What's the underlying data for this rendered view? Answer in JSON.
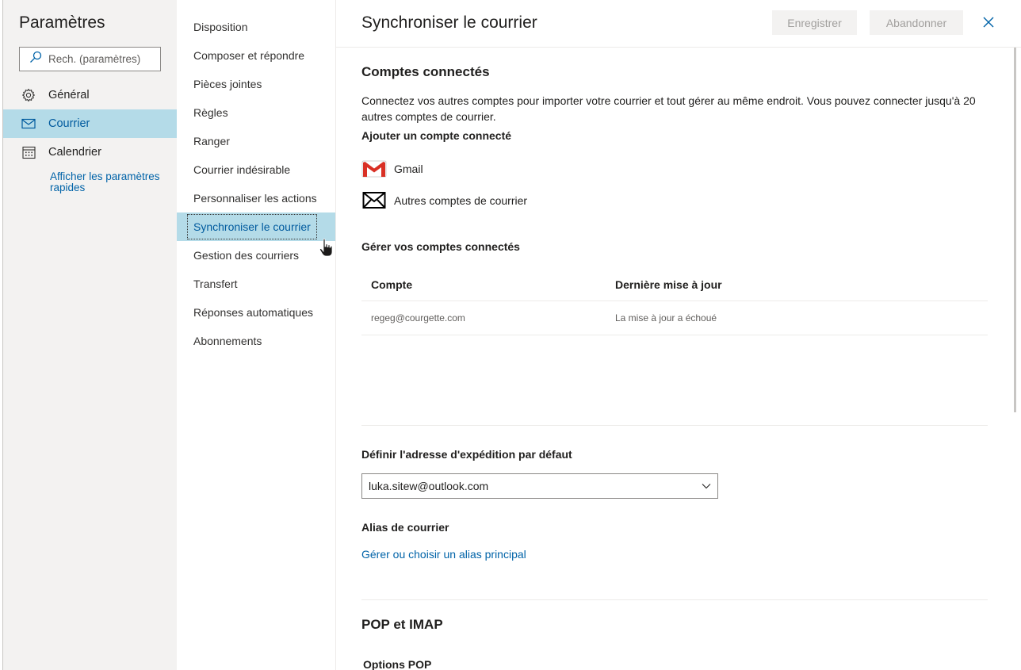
{
  "settings": {
    "title": "Paramètres",
    "search_placeholder": "Rech. (paramètres)",
    "categories": [
      {
        "label": "Général",
        "icon": "gear-icon"
      },
      {
        "label": "Courrier",
        "icon": "mail-icon",
        "active": true
      },
      {
        "label": "Calendrier",
        "icon": "calendar-icon"
      }
    ],
    "quick_settings_link": "Afficher les paramètres rapides"
  },
  "mail_nav": {
    "items": [
      "Disposition",
      "Composer et répondre",
      "Pièces jointes",
      "Règles",
      "Ranger",
      "Courrier indésirable",
      "Personnaliser les actions",
      "Synchroniser le courrier",
      "Gestion des courriers",
      "Transfert",
      "Réponses automatiques",
      "Abonnements"
    ],
    "active": "Synchroniser le courrier"
  },
  "main": {
    "title": "Synchroniser le courrier",
    "save_label": "Enregistrer",
    "discard_label": "Abandonner",
    "connected": {
      "heading": "Comptes connectés",
      "description": "Connectez vos autres comptes pour importer votre courrier et tout gérer au même endroit. Vous pouvez connecter jusqu'à 20 autres comptes de courrier.",
      "add_heading": "Ajouter un compte connecté",
      "gmail_label": "Gmail",
      "other_label": "Autres comptes de courrier",
      "manage_heading": "Gérer vos comptes connectés",
      "table": {
        "headers": [
          "Compte",
          "Dernière mise à jour"
        ],
        "rows": [
          [
            "regeg@courgette.com",
            "La mise à jour a échoué"
          ]
        ]
      }
    },
    "default_from": {
      "heading": "Définir l'adresse d'expédition par défaut",
      "value": "luka.sitew@outlook.com"
    },
    "alias": {
      "heading": "Alias de courrier",
      "link": "Gérer ou choisir un alias principal"
    },
    "pop_imap": {
      "heading": "POP et IMAP",
      "pop_options": "Options POP"
    }
  },
  "colors": {
    "accent": "#0063a8",
    "selected_bg": "#b4dbe8",
    "gmail_red": "#d93025"
  }
}
